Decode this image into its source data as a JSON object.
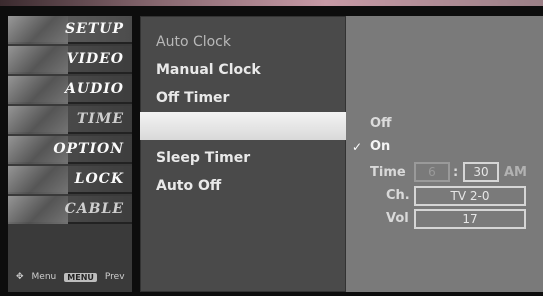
{
  "left_menu": {
    "items": [
      {
        "label": "SETUP"
      },
      {
        "label": "VIDEO"
      },
      {
        "label": "AUDIO"
      },
      {
        "label": "TIME"
      },
      {
        "label": "OPTION"
      },
      {
        "label": "LOCK"
      },
      {
        "label": "CABLE"
      }
    ],
    "footer": {
      "menu_hint": "Menu",
      "prev_key": "MENU",
      "prev_label": "Prev"
    }
  },
  "middle_menu": {
    "items": [
      {
        "label": "Auto Clock"
      },
      {
        "label": "Manual Clock"
      },
      {
        "label": "Off Timer"
      },
      {
        "label": ""
      },
      {
        "label": "Sleep Timer"
      },
      {
        "label": "Auto Off"
      }
    ]
  },
  "right_panel": {
    "options": [
      {
        "label": "Off",
        "selected": false
      },
      {
        "label": "On",
        "selected": true
      }
    ],
    "check_symbol": "✓",
    "time": {
      "label": "Time",
      "hour": "6",
      "sep": ":",
      "minute": "30",
      "ampm": "AM"
    },
    "channel": {
      "label": "Ch.",
      "value": "TV 2-0"
    },
    "volume": {
      "label": "Vol",
      "value": "17"
    }
  }
}
